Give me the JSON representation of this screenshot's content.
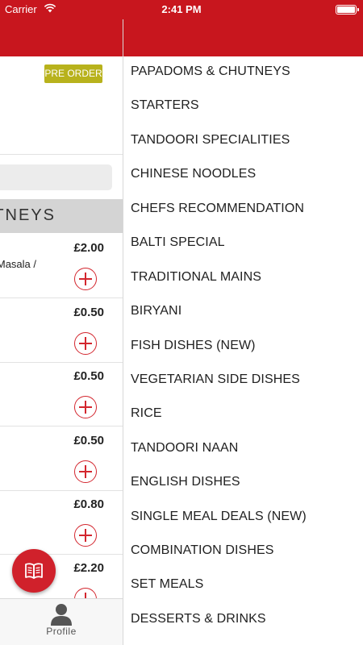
{
  "status_bar": {
    "carrier": "Carrier",
    "time": "2:41 PM"
  },
  "colors": {
    "brand_red": "#c8161e",
    "preorder_badge": "#b8b21c",
    "add_icon": "#d3262e"
  },
  "restaurant": {
    "preorder_label": "PRE ORDER"
  },
  "menu_section": {
    "title": "PAPADOMS & CHUTNEYS",
    "items": [
      {
        "price": "£2.00",
        "description": "Masala /"
      },
      {
        "price": "£0.50",
        "description": ""
      },
      {
        "price": "£0.50",
        "description": ""
      },
      {
        "price": "£0.50",
        "description": ""
      },
      {
        "price": "£0.80",
        "description": ""
      },
      {
        "price": "£2.20",
        "description": ""
      }
    ]
  },
  "bottom_tab": {
    "profile_label": "Profile"
  },
  "drawer": {
    "categories": [
      "PAPADOMS & CHUTNEYS",
      "STARTERS",
      "TANDOORI SPECIALITIES",
      "CHINESE NOODLES",
      "CHEFS RECOMMENDATION",
      "BALTI SPECIAL",
      "TRADITIONAL MAINS",
      "BIRYANI",
      "FISH DISHES (NEW)",
      "VEGETARIAN SIDE DISHES",
      "RICE",
      "TANDOORI NAAN",
      "ENGLISH DISHES",
      "SINGLE MEAL DEALS (NEW)",
      "COMBINATION DISHES",
      "SET MEALS",
      "DESSERTS & DRINKS"
    ]
  }
}
